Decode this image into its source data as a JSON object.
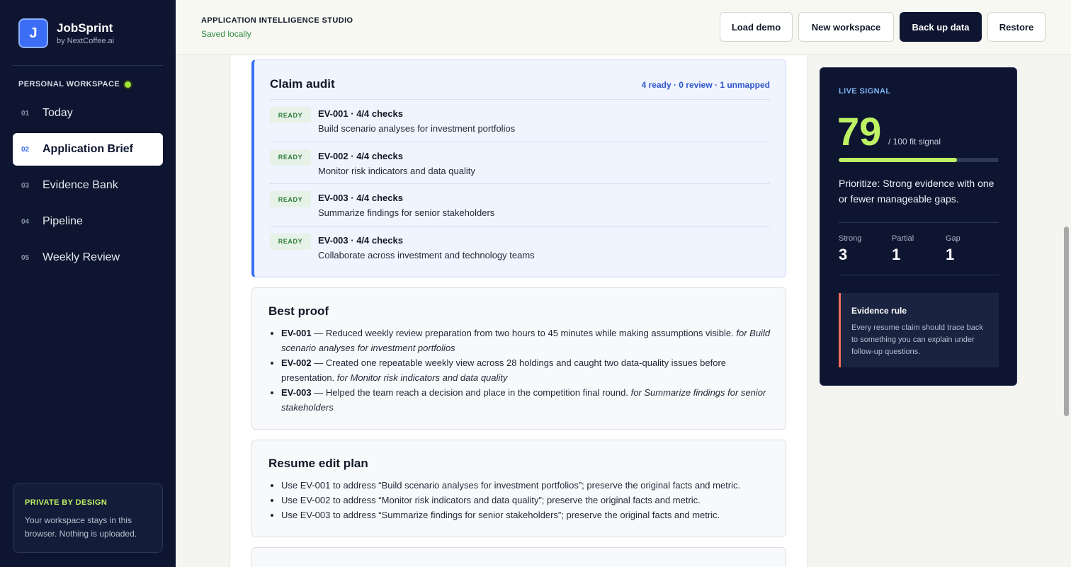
{
  "brand": {
    "logo_letter": "J",
    "name": "JobSprint",
    "sub": "by NextCoffee.ai"
  },
  "sidebar": {
    "workspace_label": "PERSONAL WORKSPACE",
    "items": [
      {
        "num": "01",
        "label": "Today"
      },
      {
        "num": "02",
        "label": "Application Brief"
      },
      {
        "num": "03",
        "label": "Evidence Bank"
      },
      {
        "num": "04",
        "label": "Pipeline"
      },
      {
        "num": "05",
        "label": "Weekly Review"
      }
    ],
    "privacy_title": "PRIVATE BY DESIGN",
    "privacy_text": "Your workspace stays in this browser. Nothing is uploaded."
  },
  "header": {
    "title": "APPLICATION INTELLIGENCE STUDIO",
    "status": "Saved locally",
    "buttons": {
      "load_demo": "Load demo",
      "new_workspace": "New workspace",
      "back_up": "Back up data",
      "restore": "Restore"
    }
  },
  "audit": {
    "title": "Claim audit",
    "summary": "4 ready · 0 review · 1 unmapped",
    "rows": [
      {
        "badge": "READY",
        "title": "EV-001 · 4/4 checks",
        "desc": "Build scenario analyses for investment portfolios"
      },
      {
        "badge": "READY",
        "title": "EV-002 · 4/4 checks",
        "desc": "Monitor risk indicators and data quality"
      },
      {
        "badge": "READY",
        "title": "EV-003 · 4/4 checks",
        "desc": "Summarize findings for senior stakeholders"
      },
      {
        "badge": "READY",
        "title": "EV-003 · 4/4 checks",
        "desc": "Collaborate across investment and technology teams"
      }
    ]
  },
  "proof": {
    "title": "Best proof",
    "items": [
      {
        "id": "EV-001",
        "text": " — Reduced weekly review preparation from two hours to 45 minutes while making assumptions visible. ",
        "for": "for Build scenario analyses for investment portfolios"
      },
      {
        "id": "EV-002",
        "text": " — Created one repeatable weekly view across 28 holdings and caught two data-quality issues before presentation. ",
        "for": "for Monitor risk indicators and data quality"
      },
      {
        "id": "EV-003",
        "text": " — Helped the team reach a decision and place in the competition final round. ",
        "for": "for Summarize findings for senior stakeholders"
      }
    ]
  },
  "resume": {
    "title": "Resume edit plan",
    "items": [
      "Use EV-001 to address “Build scenario analyses for investment portfolios”; preserve the original facts and metric.",
      "Use EV-002 to address “Monitor risk indicators and data quality”; preserve the original facts and metric.",
      "Use EV-003 to address “Summarize findings for senior stakeholders”; preserve the original facts and metric."
    ]
  },
  "signal": {
    "label": "LIVE SIGNAL",
    "score": "79",
    "score_fraction": 0.74,
    "unit": "/ 100 fit signal",
    "text": "Prioritize: Strong evidence with one or fewer manageable gaps.",
    "stats": [
      {
        "label": "Strong",
        "value": "3"
      },
      {
        "label": "Partial",
        "value": "1"
      },
      {
        "label": "Gap",
        "value": "1"
      }
    ],
    "rule_title": "Evidence rule",
    "rule_text": "Every resume claim should trace back to something you can explain under follow-up questions."
  },
  "colors": {
    "accent": "#3b6ef5",
    "lime": "#bef264",
    "navy": "#0d1530",
    "ready_green": "#2f7d3a"
  }
}
